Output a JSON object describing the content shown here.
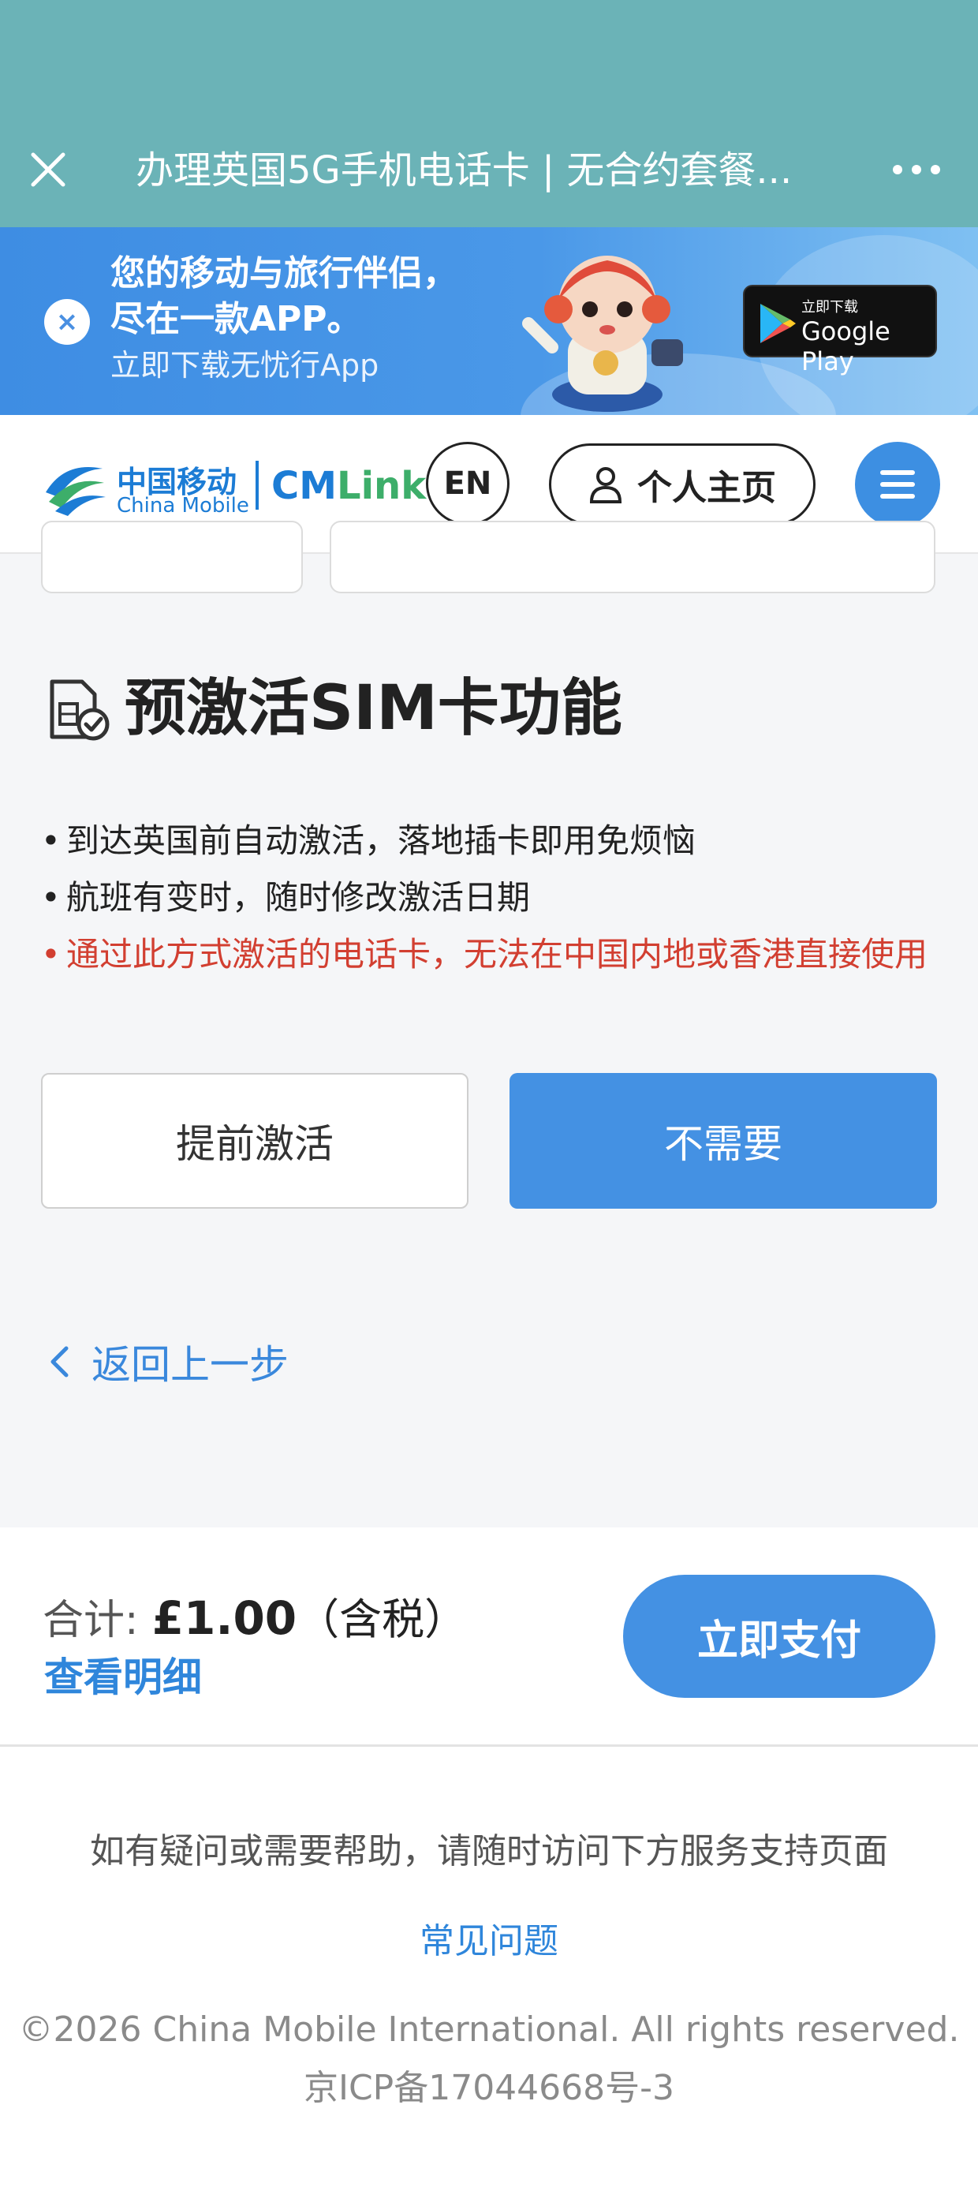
{
  "titlebar": {
    "title": "办理英国5G手机电话卡 | 无合约套餐..."
  },
  "banner": {
    "line1": "您的移动与旅行伴侣，",
    "line2": "尽在一款APP。",
    "line3": "立即下载无忧行App",
    "store_small": "立即下载",
    "store_big": "Google Play"
  },
  "header": {
    "logo_cn": "中国移动",
    "logo_en": "China Mobile",
    "logo_brand_a": "CM",
    "logo_brand_b": "Link",
    "lang_label": "EN",
    "profile_label": "个人主页"
  },
  "section": {
    "title": "预激活SIM卡功能",
    "bullets": [
      "到达英国前自动激活，落地插卡即用免烦恼",
      "航班有变时，随时修改激活日期"
    ],
    "warning": "通过此方式激活的电话卡，无法在中国内地或香港直接使用",
    "options": {
      "activate": "提前激活",
      "skip": "不需要"
    }
  },
  "back_label": "返回上一步",
  "total": {
    "label": "合计:",
    "amount": "£1.00",
    "tax_note": "（含税）",
    "detail_link": "查看明细",
    "pay_button": "立即支付"
  },
  "footer": {
    "help_text": "如有疑问或需要帮助，请随时访问下方服务支持页面",
    "faq_link": "常见问题",
    "copyright": "©2026 China Mobile International. All rights reserved.",
    "icp": "京ICP备17044668号-3"
  },
  "colors": {
    "primary": "#4491e3",
    "teal_bar": "#6bb3b7",
    "warning": "#d23f31",
    "link": "#2f86db"
  }
}
